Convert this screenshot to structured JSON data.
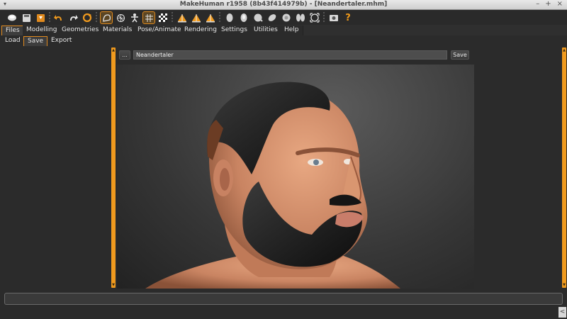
{
  "window": {
    "title": "MakeHuman r1958 (8b43f414979b) - [Neandertaler.mhm]",
    "menu_glyph": "▾",
    "controls": [
      "–",
      "+",
      "×"
    ]
  },
  "toolbar": {
    "icons": [
      "new-file-icon",
      "save-file-icon",
      "export-icon",
      "undo-icon",
      "redo-icon",
      "reset-icon",
      "smooth-icon",
      "wireframe-icon",
      "pose-icon",
      "grid-icon",
      "checker-icon",
      "front-view-icon",
      "side-view-icon",
      "back-view-icon",
      "head-shape-1-icon",
      "head-shape-2-icon",
      "head-shape-3-icon",
      "head-shape-4-icon",
      "head-shape-5-icon",
      "head-shape-6-icon",
      "reset-camera-icon",
      "screenshot-icon",
      "help-icon"
    ],
    "help_label": "?"
  },
  "tabs": [
    "Files",
    "Modelling",
    "Geometries",
    "Materials",
    "Pose/Animate",
    "Rendering",
    "Settings",
    "Utilities",
    "Help"
  ],
  "active_tab": "Files",
  "subtabs": [
    "Load",
    "Save",
    "Export"
  ],
  "active_subtab": "Save",
  "save_panel": {
    "browse_label": "...",
    "filename_value": "Neandertaler",
    "save_label": "Save"
  },
  "statusbar": {
    "text": ""
  },
  "corner_button": {
    "label": "<"
  },
  "colors": {
    "accent": "#f09a1e",
    "background": "#2b2b2b",
    "field": "#4d4d4d",
    "skin": "#d8906a",
    "hair": "#1a1a1a"
  }
}
